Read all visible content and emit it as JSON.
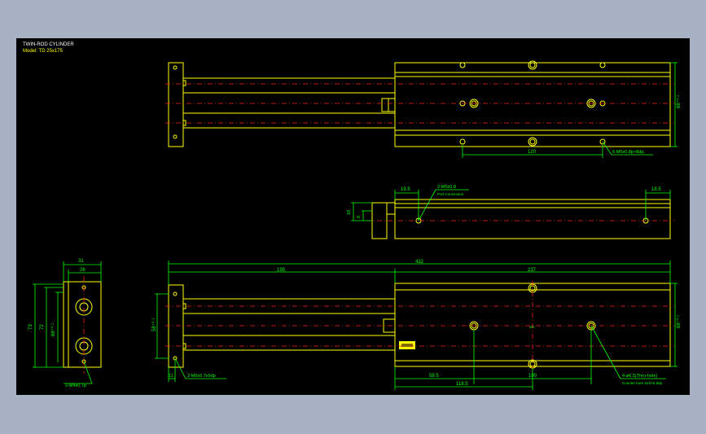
{
  "colors": {
    "background": "#a7b1c3",
    "canvas": "#000000",
    "outline": "#ffff00",
    "dimension": "#00ff00",
    "centerline": "#ff2020",
    "text": "#ffffff"
  },
  "title_block": {
    "title": "TWIN-ROD CYLINDER",
    "model": "Model: TD 25x175"
  },
  "top_view": {
    "dim_spacing": "120",
    "callout_tapped": "6-M6x0.8p×8dp.",
    "dim_height": "68⁺⁰·¹"
  },
  "middle_view": {
    "dim_left_offset": "19.5",
    "dim_right_offset": "18.5",
    "dim_port_height": "18",
    "dim_port_small": "8",
    "port_callout": "2-M5x0.8",
    "port_label": "Port Connection"
  },
  "bottom_view": {
    "dim_total": "432",
    "dim_rod": "195",
    "dim_body": "237",
    "dim_height": "68⁺⁰·¹",
    "dim_plate_height": "58⁺⁰·¹",
    "dim_58_5": "58.5",
    "dim_100": "100",
    "dim_118_5": "118.5",
    "dim_11": "11",
    "callout_plate_holes": "2-M6x0.7x5dp",
    "callout_through_holes": "4-ø6.5(Thru-hole)",
    "counterbore_note": "Counter bore ø10×5.8dp",
    "center_text": "MK"
  },
  "end_view": {
    "dim_width_outer": "31",
    "dim_width_inner": "26",
    "dim_height_outer": "73",
    "dim_height_mid": "72",
    "dim_height_inner": "68⁺⁰·¹",
    "callout_tapped": "2-M4x0.7p"
  }
}
